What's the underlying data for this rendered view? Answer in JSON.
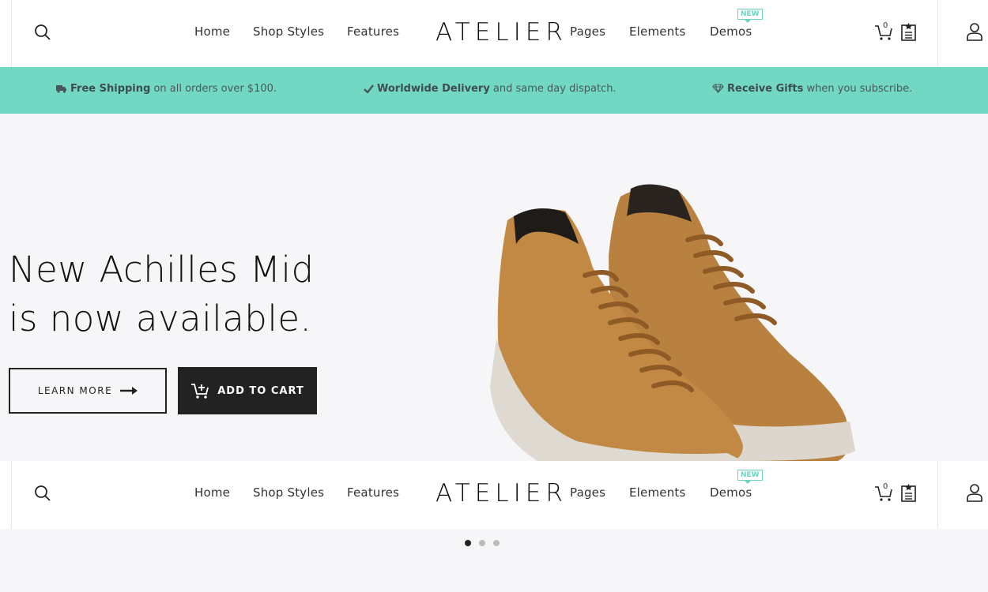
{
  "brand": {
    "logo": "ATELIER"
  },
  "nav": {
    "home": "Home",
    "shop_styles": "Shop Styles",
    "features": "Features",
    "pages": "Pages",
    "elements": "Elements",
    "demos": "Demos",
    "demos_badge": "NEW"
  },
  "cart": {
    "count": "0"
  },
  "promo": {
    "shipping_bold": "Free Shipping",
    "shipping_text": " on all orders over $100.",
    "delivery_bold": "Worldwide Delivery",
    "delivery_text": " and same day dispatch.",
    "gifts_bold": "Receive Gifts",
    "gifts_text": " when you subscribe."
  },
  "hero": {
    "headline_line1": "New Achilles Mid",
    "headline_line2": "is now available.",
    "learn_more": "LEARN MORE",
    "add_to_cart": "ADD TO CART"
  },
  "slider": {
    "active_index": 0,
    "count": 3
  },
  "colors": {
    "accent": "#72d8c4",
    "badge": "#6fd3c1",
    "dark": "#222222",
    "hero_bg": "#f6f6f8"
  },
  "icons": [
    "search-icon",
    "cart-icon",
    "wishlist-icon",
    "user-icon",
    "truck-icon",
    "check-icon",
    "diamond-icon",
    "arrow-right-icon",
    "add-cart-icon"
  ]
}
